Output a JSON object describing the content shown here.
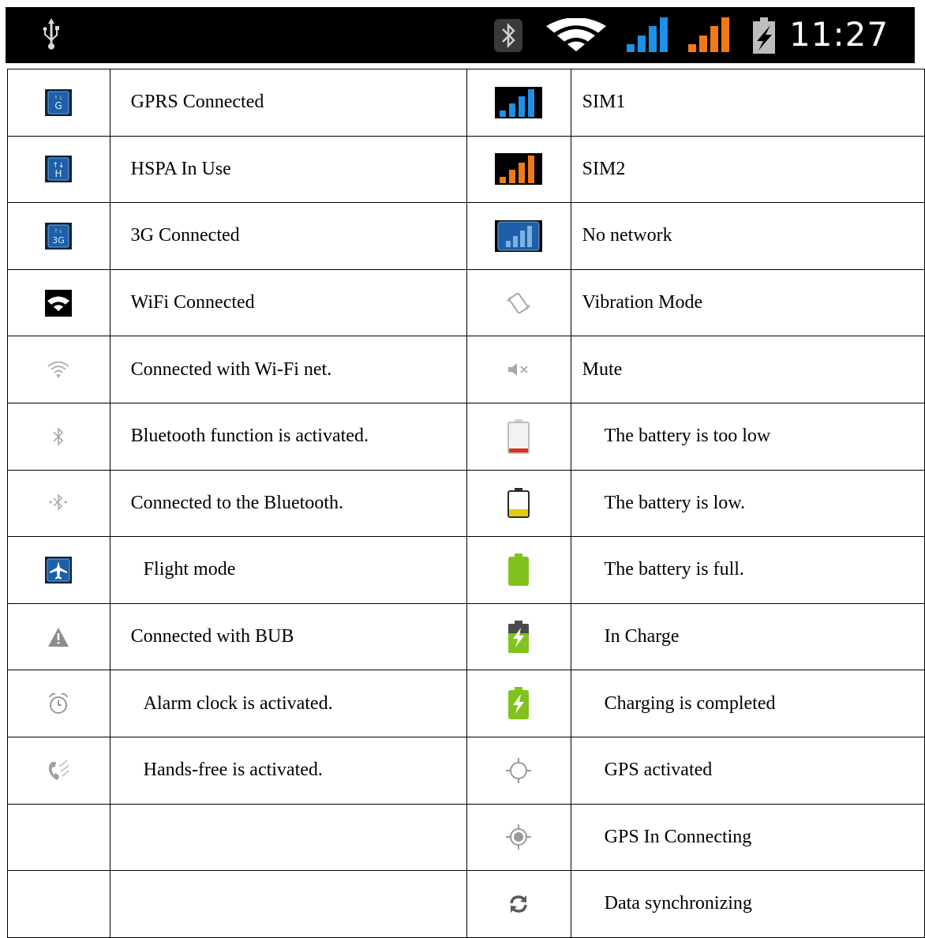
{
  "status_bar": {
    "time": "11:27",
    "icons": [
      "usb-icon",
      "bluetooth-icon",
      "wifi-icon",
      "signal-sim1-icon",
      "signal-sim2-icon",
      "battery-charging-icon"
    ]
  },
  "left_column": [
    {
      "icon": "gprs-icon",
      "label": "GPRS Connected"
    },
    {
      "icon": "hspa-icon",
      "label": "HSPA In Use"
    },
    {
      "icon": "3g-icon",
      "label": "3G Connected"
    },
    {
      "icon": "wifi-connected-icon",
      "label": "WiFi Connected"
    },
    {
      "icon": "wifi-net-icon",
      "label": "Connected with Wi-Fi net."
    },
    {
      "icon": "bluetooth-icon",
      "label": "Bluetooth function is activated."
    },
    {
      "icon": "bluetooth-connected-icon",
      "label": "Connected to the Bluetooth."
    },
    {
      "icon": "flight-mode-icon",
      "label": "Flight mode"
    },
    {
      "icon": "warning-icon",
      "label": "Connected with BUB"
    },
    {
      "icon": "alarm-clock-icon",
      "label": "Alarm clock is activated."
    },
    {
      "icon": "hands-free-icon",
      "label": "Hands-free is activated."
    },
    {
      "icon": "",
      "label": ""
    },
    {
      "icon": "",
      "label": ""
    }
  ],
  "right_column": [
    {
      "icon": "signal-sim1-icon",
      "label": "SIM1"
    },
    {
      "icon": "signal-sim2-icon",
      "label": "SIM2"
    },
    {
      "icon": "no-network-icon",
      "label": "No network"
    },
    {
      "icon": "vibration-icon",
      "label": "Vibration Mode"
    },
    {
      "icon": "mute-icon",
      "label": "Mute"
    },
    {
      "icon": "battery-too-low-icon",
      "label": "The battery is too low"
    },
    {
      "icon": "battery-low-icon",
      "label": "The battery is low."
    },
    {
      "icon": "battery-full-icon",
      "label": "The battery is full."
    },
    {
      "icon": "battery-charging-icon",
      "label": "In Charge"
    },
    {
      "icon": "battery-charged-icon",
      "label": "Charging is completed"
    },
    {
      "icon": "gps-activated-icon",
      "label": "GPS activated"
    },
    {
      "icon": "gps-connecting-icon",
      "label": "GPS In Connecting"
    },
    {
      "icon": "sync-icon",
      "label": "Data synchronizing"
    }
  ],
  "colors": {
    "sim1_signal": "#1e90e6",
    "sim2_signal": "#f07a18",
    "tile_blue": "#1d5fa8",
    "battery_red": "#d8321e",
    "battery_yellow": "#e3cc10",
    "battery_green": "#7fc31c"
  }
}
